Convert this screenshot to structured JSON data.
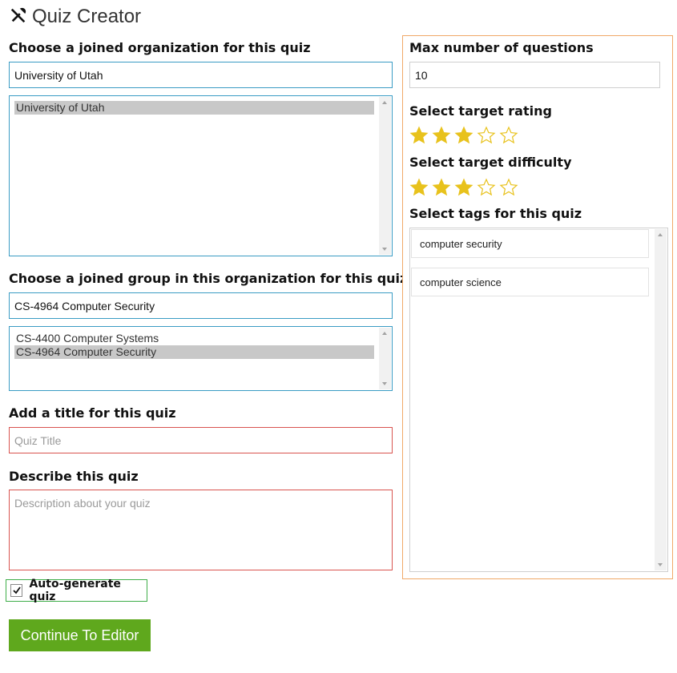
{
  "header": {
    "title": "Quiz Creator",
    "icon": "tools-icon"
  },
  "organization": {
    "label": "Choose a joined organization for this quiz",
    "input_value": "University of Utah",
    "options": [
      {
        "label": "University of Utah",
        "selected": true
      }
    ]
  },
  "group": {
    "label": "Choose a joined group in this organization for this quiz",
    "input_value": "CS-4964 Computer Security",
    "options": [
      {
        "label": "CS-4400 Computer Systems",
        "selected": false
      },
      {
        "label": "CS-4964 Computer Security",
        "selected": true
      }
    ]
  },
  "quiz_title": {
    "label": "Add a title for this quiz",
    "placeholder": "Quiz Title"
  },
  "description": {
    "label": "Describe this quiz",
    "placeholder": "Description about your quiz"
  },
  "auto_generate": {
    "label": "Auto-generate quiz",
    "checked": true
  },
  "continue_button": {
    "label": "Continue To Editor"
  },
  "side_panel": {
    "max_questions_label": "Max number of questions",
    "max_questions_value": "10",
    "rating_label": "Select target rating",
    "rating": {
      "value": 3,
      "max": 5
    },
    "difficulty_label": "Select target difficulty",
    "difficulty": {
      "value": 3,
      "max": 5
    },
    "tags_label": "Select tags for this quiz",
    "tags": [
      "computer security",
      "computer science"
    ]
  },
  "colors": {
    "accent_button": "#5fa81d",
    "star_filled": "#e8c21c",
    "valid_border": "#3a9cc4",
    "invalid_border": "#d9534f",
    "panel_border": "#f0a868",
    "checkbox_border": "#3fae49"
  }
}
